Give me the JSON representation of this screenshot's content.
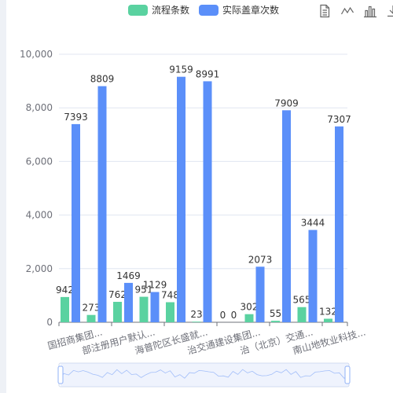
{
  "colors": {
    "series1": "#5ad2a0",
    "series2": "#5b8ff9",
    "axis": "#6e7079",
    "grid": "#e0e6f1"
  },
  "toolbox": {
    "icons": [
      "data-view-icon",
      "line-chart-icon",
      "bar-chart-icon",
      "download-icon"
    ]
  },
  "chart_data": {
    "type": "bar",
    "categories": [
      "国招商集团...",
      "部注册用户默认...",
      "海普陀区长盛就...",
      "治交通建设集团...",
      "治（北京）交通...",
      "南山地牧业科技..."
    ],
    "categories_full_count": 12,
    "series": [
      {
        "name": "流程条数",
        "color": "#5ad2a0",
        "values": [
          942,
          273,
          762,
          951,
          748,
          23,
          0,
          302,
          55,
          565,
          132
        ]
      },
      {
        "name": "实际盖章次数",
        "color": "#5b8ff9",
        "values": [
          7393,
          8809,
          1469,
          1129,
          9159,
          8991,
          0,
          2073,
          7909,
          3444,
          7307
        ]
      }
    ],
    "ylim": [
      0,
      10000
    ],
    "yticks": [
      "0",
      "2,000",
      "4,000",
      "6,000",
      "8,000",
      "10,000"
    ],
    "ytick_values": [
      0,
      2000,
      4000,
      6000,
      8000,
      10000
    ],
    "legend_position": "top-center",
    "grid": true,
    "dataZoom": true
  }
}
